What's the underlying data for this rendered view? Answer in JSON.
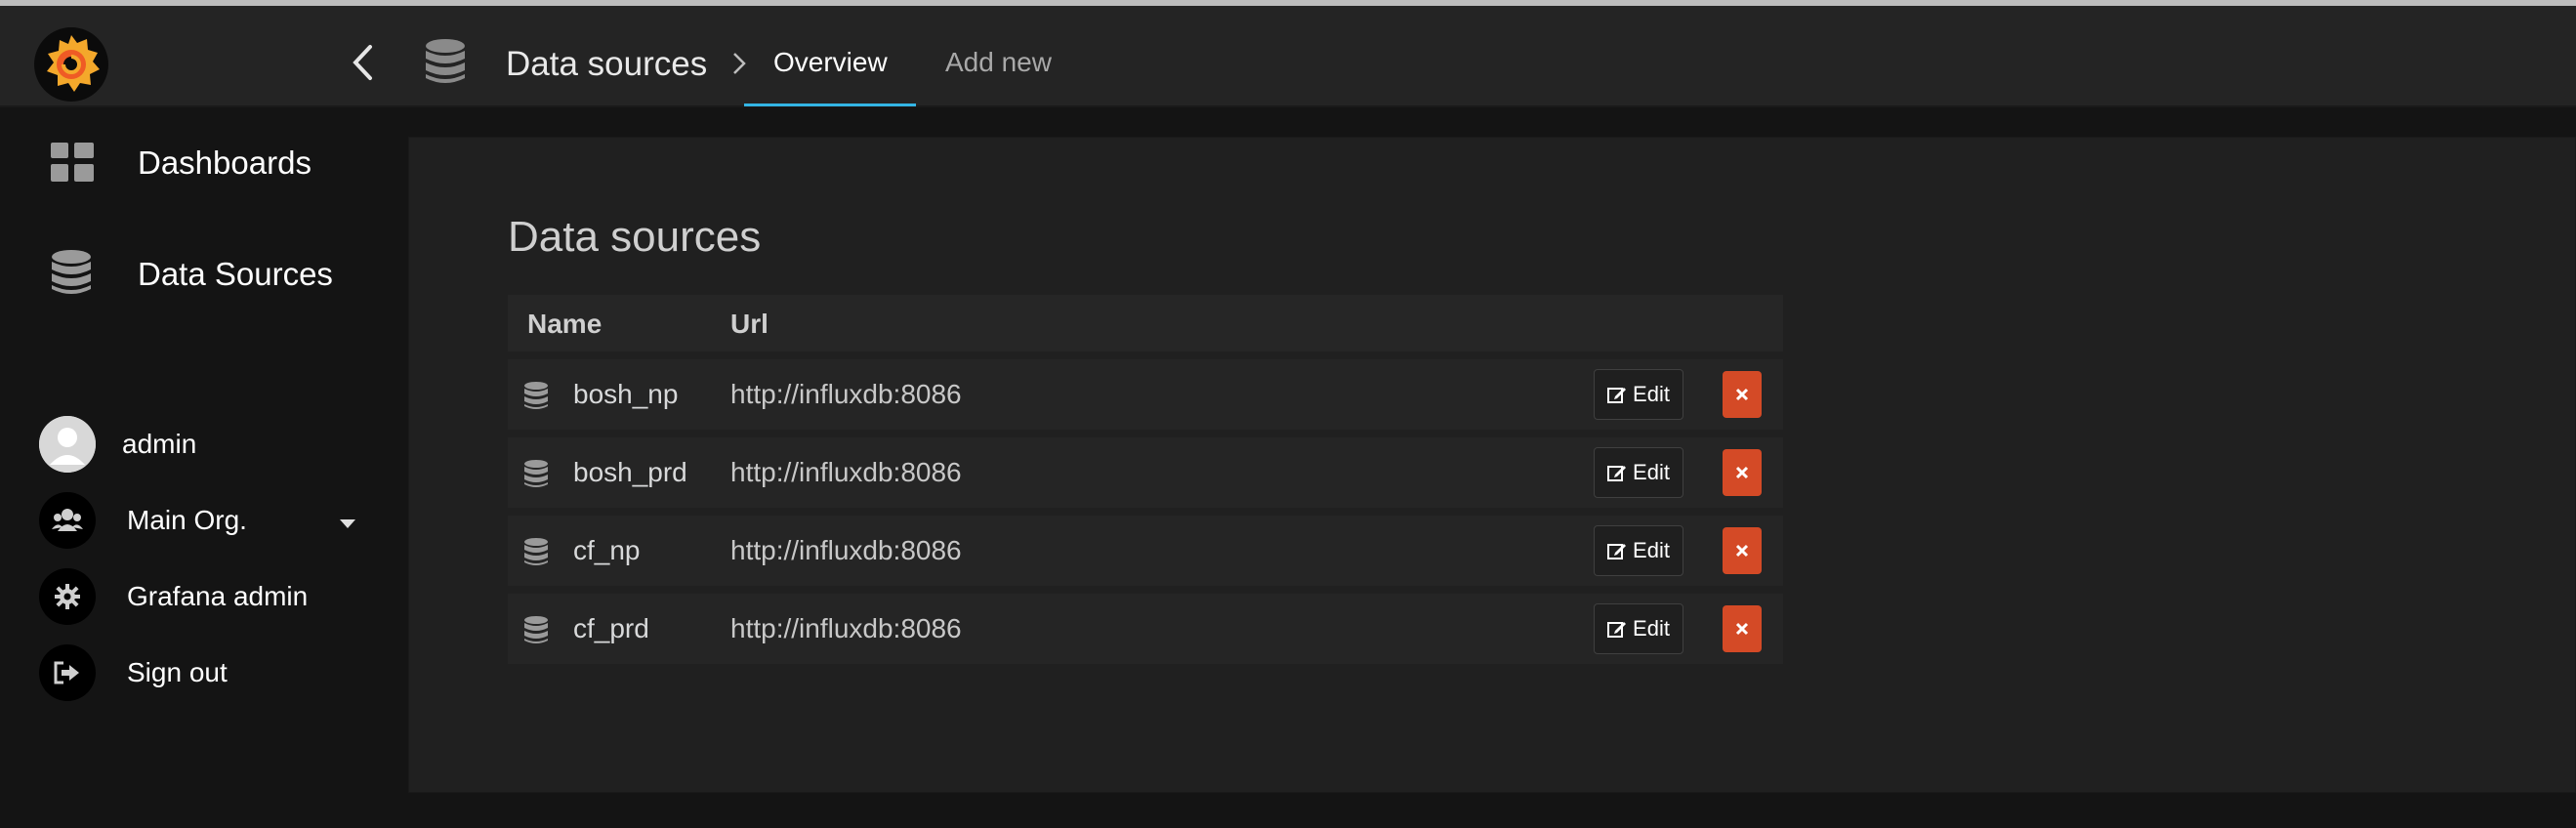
{
  "navbar": {
    "title": "Data sources",
    "tabs": [
      {
        "label": "Overview",
        "active": true
      },
      {
        "label": "Add new",
        "active": false
      }
    ],
    "icons": {
      "logo": "grafana-logo",
      "back": "chevron-left-icon",
      "section": "database-icon",
      "separator": "chevron-right-icon"
    }
  },
  "sidebar": {
    "items": [
      {
        "label": "Dashboards",
        "icon": "dashboards-grid-icon"
      },
      {
        "label": "Data Sources",
        "icon": "database-icon"
      }
    ],
    "user": {
      "name": "admin",
      "icon": "avatar"
    },
    "org": {
      "label": "Main Org.",
      "icon": "users-icon",
      "caret": "caret-down-icon"
    },
    "admin": {
      "label": "Grafana admin",
      "icon": "gear-icon"
    },
    "signout": {
      "label": "Sign out",
      "icon": "sign-out-icon"
    }
  },
  "main": {
    "title": "Data sources",
    "columns": [
      "Name",
      "Url"
    ],
    "rows": [
      {
        "name": "bosh_np",
        "url": "http://influxdb:8086"
      },
      {
        "name": "bosh_prd",
        "url": "http://influxdb:8086"
      },
      {
        "name": "cf_np",
        "url": "http://influxdb:8086"
      },
      {
        "name": "cf_prd",
        "url": "http://influxdb:8086"
      }
    ],
    "edit_label": "Edit",
    "delete_icon": "close-icon"
  },
  "colors": {
    "accent": "#33b5e5",
    "danger": "#d44a26",
    "navbar_bg": "#242424",
    "page_bg": "#141414",
    "panel_bg": "#202020"
  }
}
